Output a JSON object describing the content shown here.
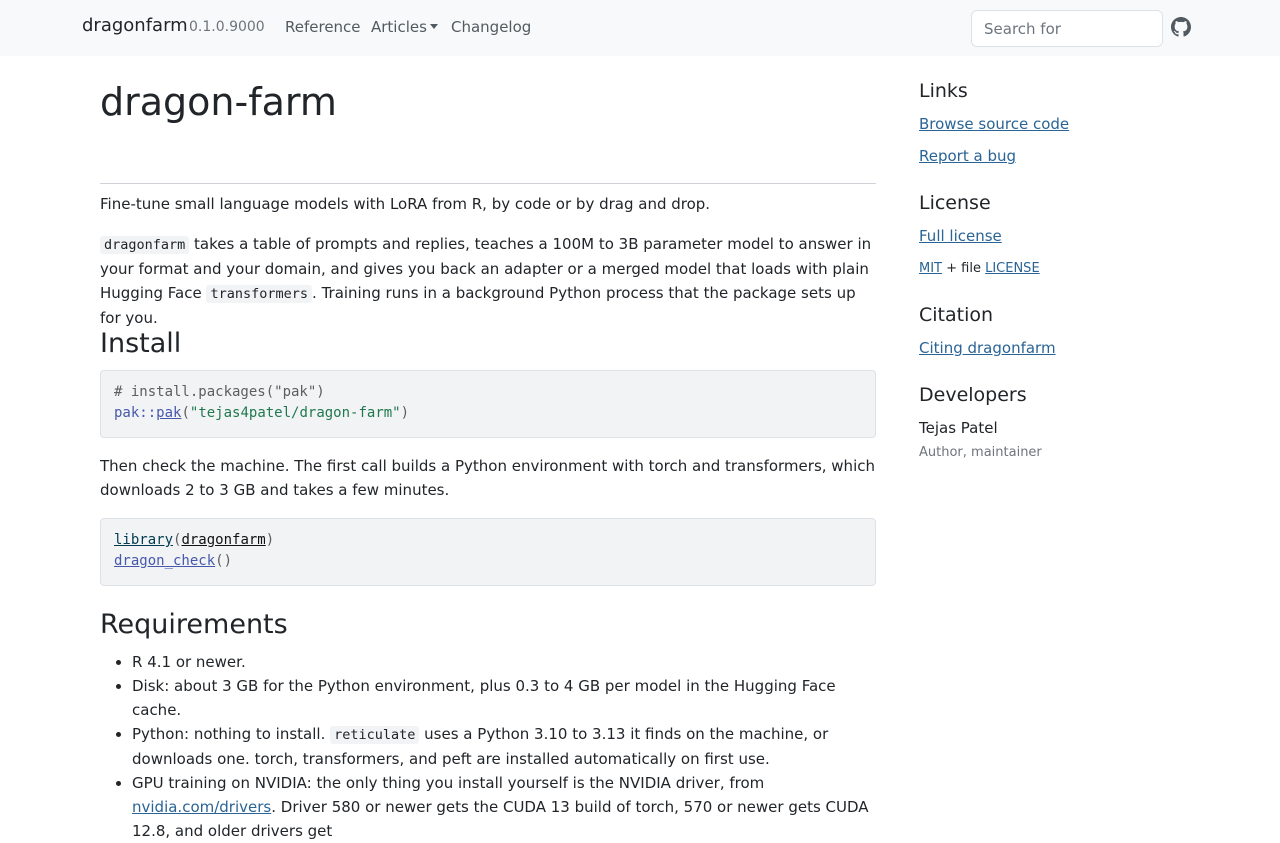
{
  "navbar": {
    "brand": "dragonfarm",
    "version": "0.1.0.9000",
    "links": [
      "Reference",
      "Articles",
      "Changelog"
    ],
    "search_placeholder": "Search for",
    "github_icon": "github-icon"
  },
  "main": {
    "title": "dragon-farm",
    "tagline": "Fine-tune small language models with LoRA from R, by code or by drag and drop.",
    "intro": {
      "code1": "dragonfarm",
      "text1": " takes a table of prompts and replies, teaches a 100M to 3B parameter model to answer in your format and your domain, and gives you back an adapter or a merged model that loads with plain Hugging Face ",
      "code2": "transformers",
      "text2": ". Training runs in a background Python process that the package sets up for you."
    },
    "install": {
      "heading": "Install",
      "code_comment": "# install.packages(\"pak\")",
      "code_ns": "pak::",
      "code_fn": "pak",
      "code_open": "(",
      "code_str": "\"tejas4patel/dragon-farm\"",
      "code_close": ")",
      "then_text": "Then check the machine. The first call builds a Python environment with torch and transformers, which downloads 2 to 3 GB and takes a few minutes.",
      "code2_lib": "library",
      "code2_open": "(",
      "code2_pkg": "dragonfarm",
      "code2_close": ")",
      "code2_fn": "dragon_check",
      "code2_call": "()"
    },
    "requirements": {
      "heading": "Requirements",
      "item1": "R 4.1 or newer.",
      "item2": "Disk: about 3 GB for the Python environment, plus 0.3 to 4 GB per model in the Hugging Face cache.",
      "item3_pre": "Python: nothing to install. ",
      "item3_code": "reticulate",
      "item3_post": " uses a Python 3.10 to 3.13 it finds on the machine, or downloads one. torch, transformers, and peft are installed automatically on first use.",
      "item4_pre": "GPU training on NVIDIA: the only thing you install yourself is the NVIDIA driver, from ",
      "item4_link": "nvidia.com/drivers",
      "item4_post": ". Driver 580 or newer gets the CUDA 13 build of torch, 570 or newer gets CUDA 12.8, and older drivers get"
    }
  },
  "sidebar": {
    "links_heading": "Links",
    "browse_source": "Browse source code",
    "report_bug": "Report a bug",
    "license_heading": "License",
    "full_license": "Full license",
    "license_mit": "MIT",
    "license_plus": " + file ",
    "license_file": "LICENSE",
    "citation_heading": "Citation",
    "citing": "Citing dragonfarm",
    "developers_heading": "Developers",
    "dev_name": "Tejas Patel",
    "dev_role": "Author, maintainer"
  }
}
